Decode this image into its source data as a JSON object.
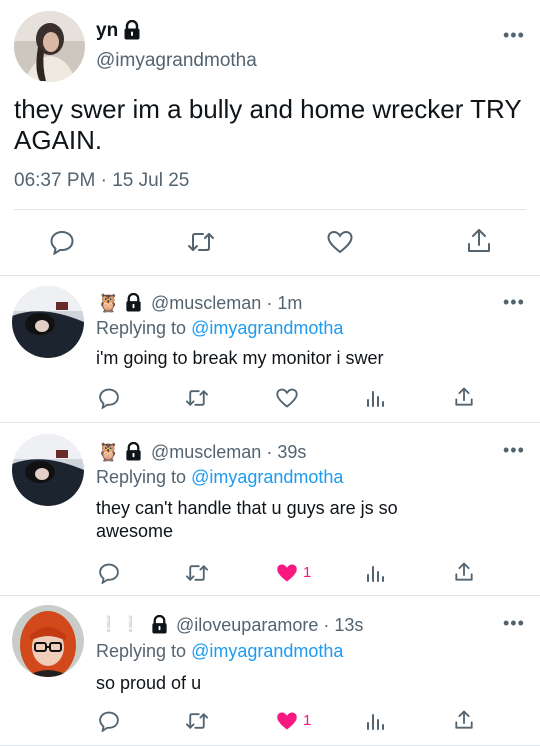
{
  "main_tweet": {
    "name": "yn",
    "handle": "@imyagrandmotha",
    "text": "they swer im a bully and home wrecker TRY AGAIN.",
    "time": "06:37 PM · 15 Jul 25",
    "icons": [
      "comment-icon",
      "retweet-icon",
      "heart-icon",
      "share-icon"
    ]
  },
  "replies": [
    {
      "handle": "@muscleman",
      "time": "1m",
      "replying_prefix": "Replying to ",
      "replying_to": "@imyagrandmotha",
      "text": "i'm going to break my monitor i swer",
      "likes": "",
      "liked": false
    },
    {
      "handle": "@muscleman",
      "time": "39s",
      "replying_prefix": "Replying to ",
      "replying_to": "@imyagrandmotha",
      "text": "they can't handle that u guys are js so awesome",
      "likes": "1",
      "liked": true
    },
    {
      "handle": "@iloveuparamore",
      "time": "13s",
      "replying_prefix": "Replying to ",
      "replying_to": "@imyagrandmotha",
      "text": "so proud of u",
      "likes": "1",
      "liked": true
    }
  ],
  "colors": {
    "accent": "#1d9bf0",
    "like": "#f91880",
    "muted": "#536471",
    "text": "#0f1419"
  }
}
